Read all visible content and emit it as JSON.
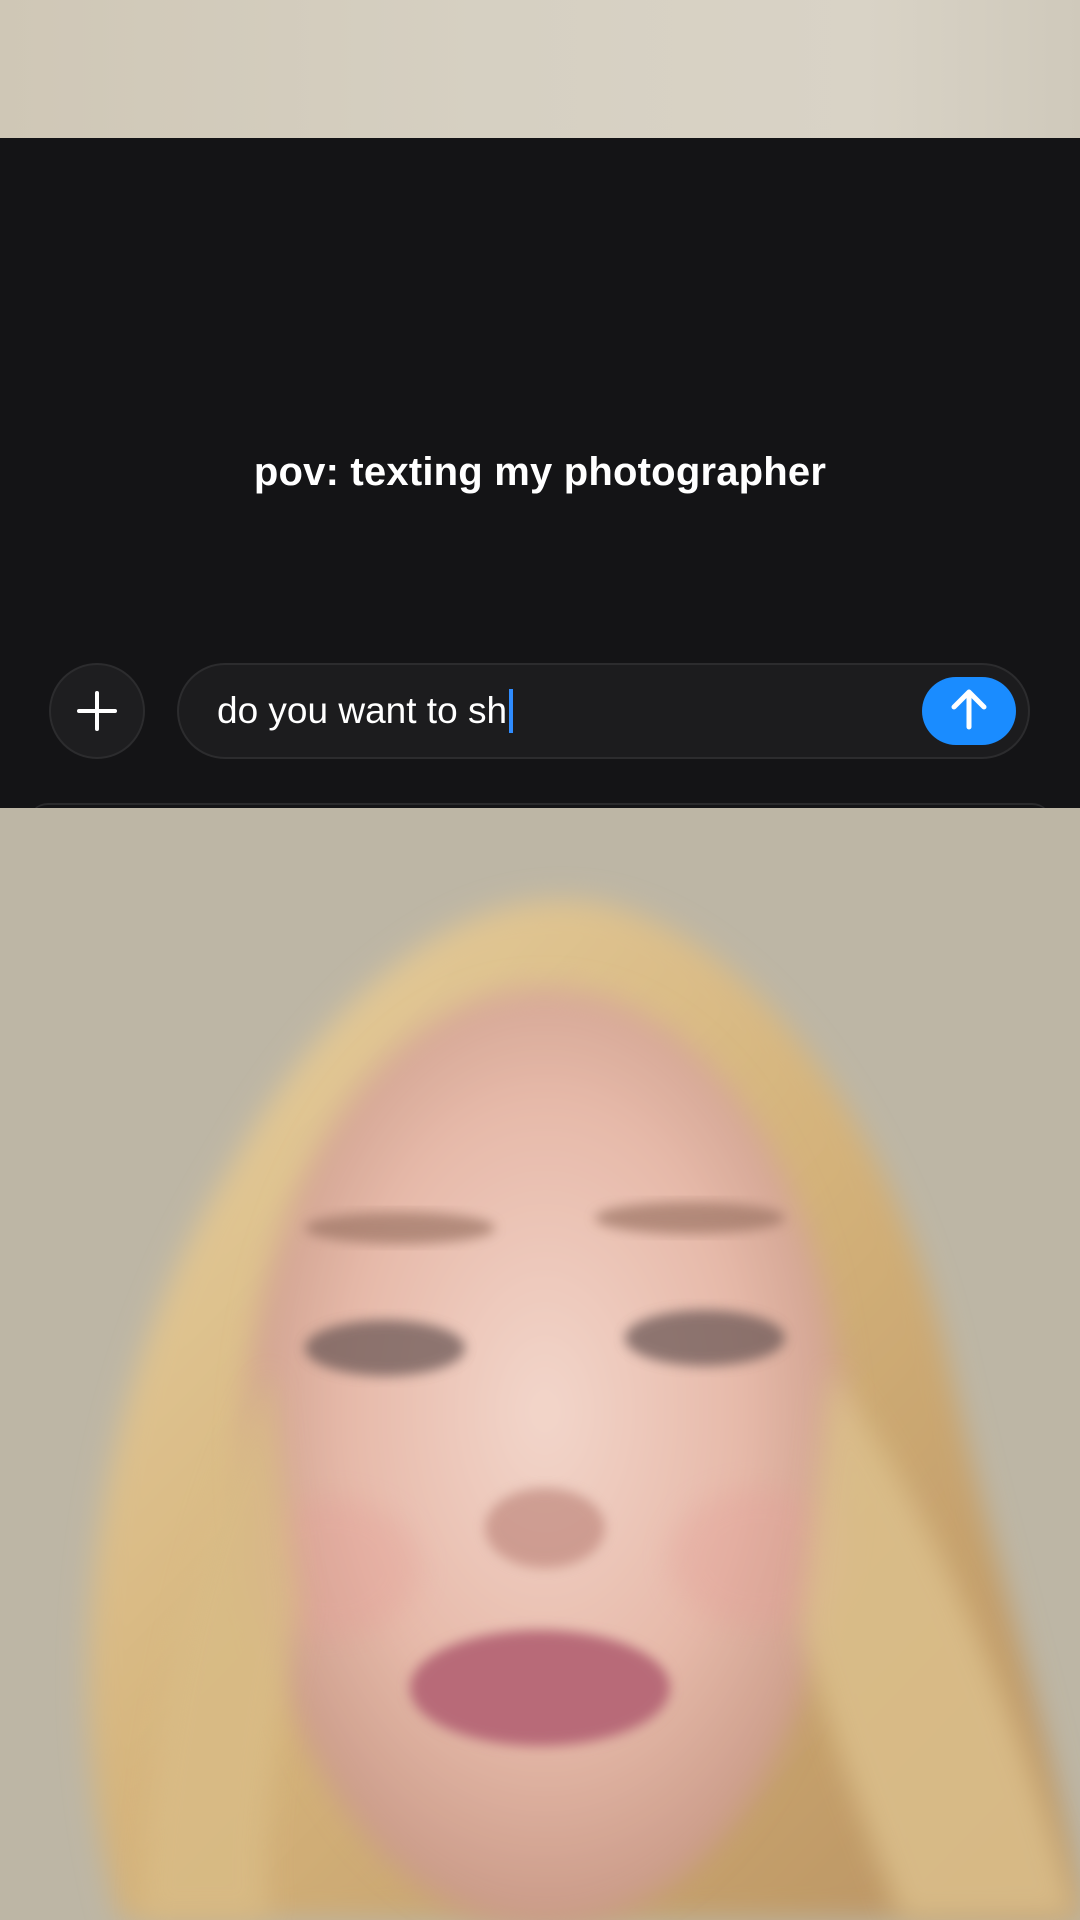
{
  "caption": "pov: texting my photographer",
  "composer": {
    "plus_icon": "plus-icon",
    "text": "do you want to sh",
    "send_icon": "arrow-up-icon"
  },
  "colors": {
    "overlay_bg": "#141416",
    "send_blue": "#1a8cff",
    "caption": "#ffffff"
  }
}
